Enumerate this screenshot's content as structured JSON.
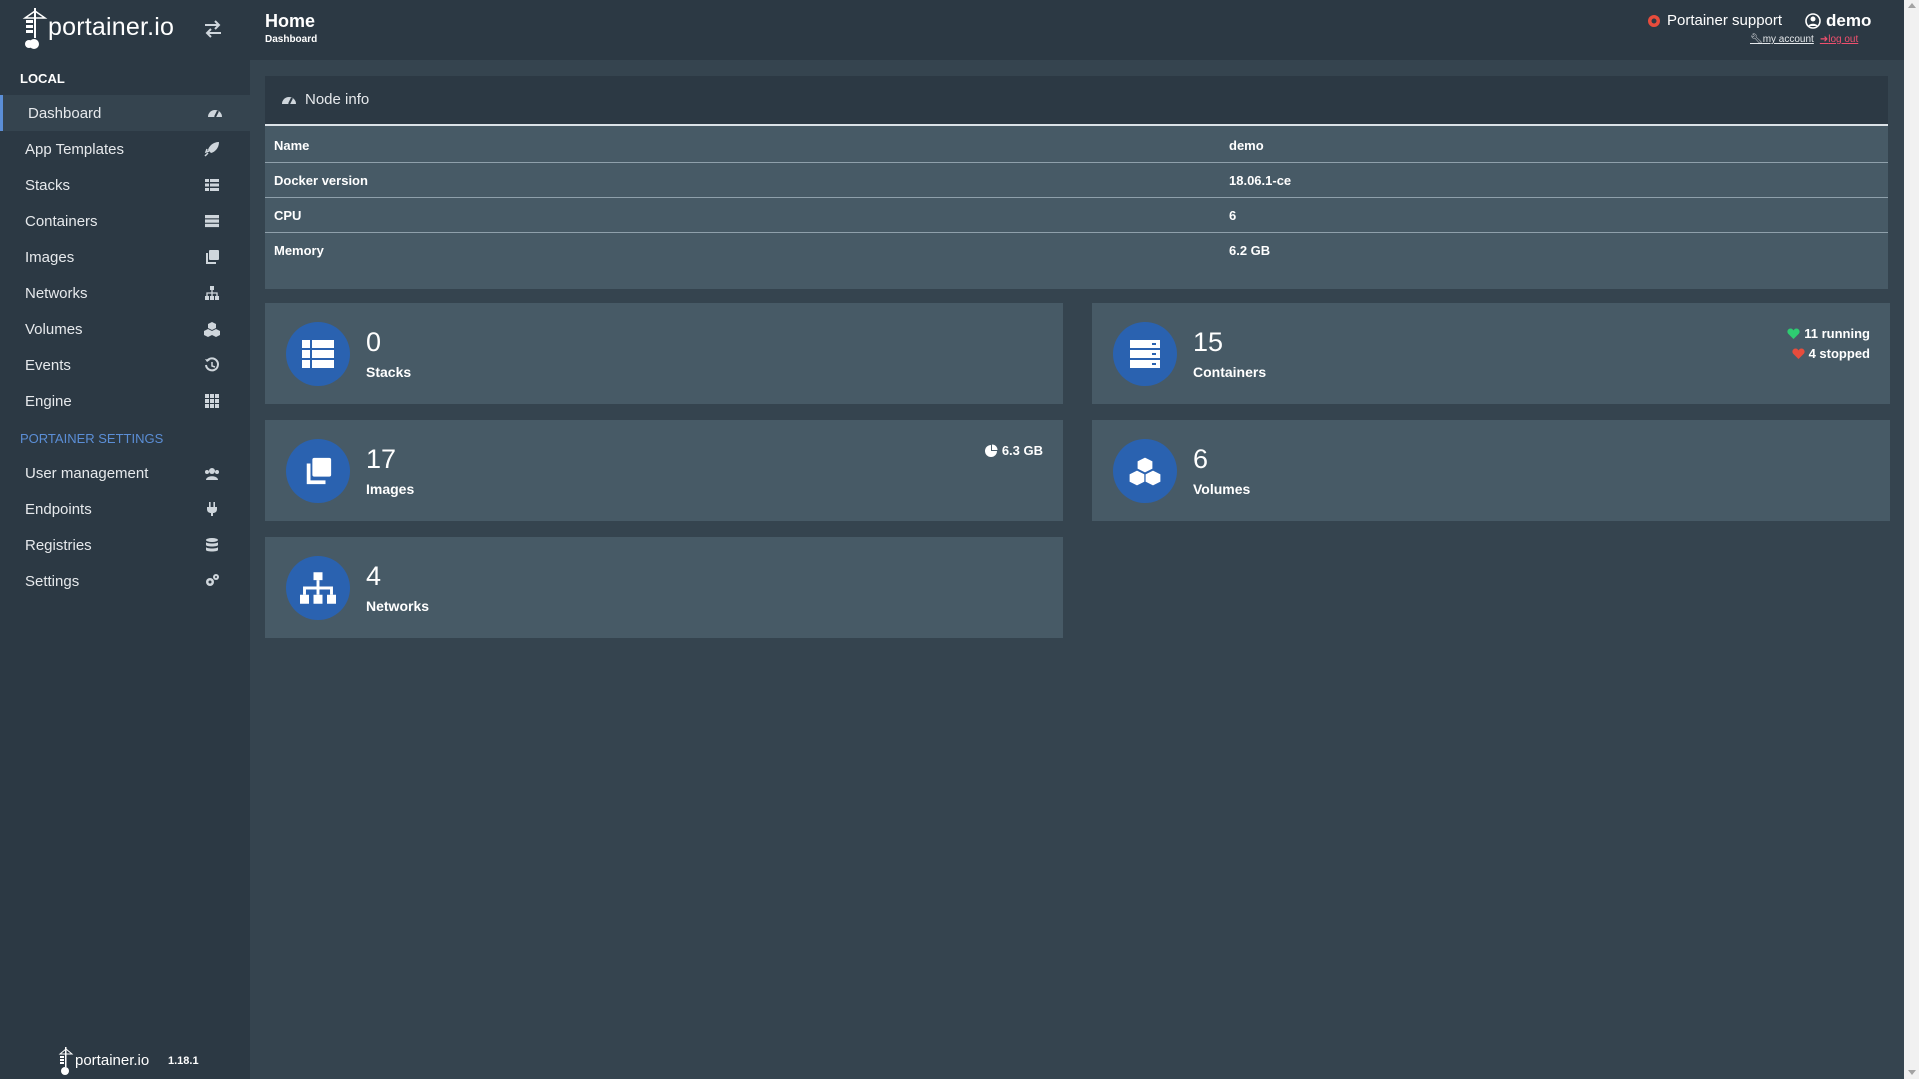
{
  "colors": {
    "sidebar_bg": "#2c3944",
    "content_bg": "#35444f",
    "panel_bg": "#475a66",
    "accent": "#5b8ed6",
    "tile_icon_bg": "#2a62b0",
    "running": "#2ecc71",
    "stopped": "#e74c3c",
    "logout": "#f0506e"
  },
  "brand": {
    "name": "portainer.io",
    "icon": "portainer-crane-icon",
    "toggle_icon": "exchange-arrows-icon"
  },
  "sidebar": {
    "section_local": "LOCAL",
    "items": [
      {
        "label": "Dashboard",
        "icon": "tachometer-icon",
        "active": true
      },
      {
        "label": "App Templates",
        "icon": "rocket-icon"
      },
      {
        "label": "Stacks",
        "icon": "th-list-icon"
      },
      {
        "label": "Containers",
        "icon": "server-icon"
      },
      {
        "label": "Images",
        "icon": "clone-icon"
      },
      {
        "label": "Networks",
        "icon": "sitemap-icon"
      },
      {
        "label": "Volumes",
        "icon": "cubes-icon"
      },
      {
        "label": "Events",
        "icon": "history-icon"
      },
      {
        "label": "Engine",
        "icon": "th-icon"
      }
    ],
    "section_settings": "PORTAINER SETTINGS",
    "settings_items": [
      {
        "label": "User management",
        "icon": "users-icon"
      },
      {
        "label": "Endpoints",
        "icon": "plug-icon"
      },
      {
        "label": "Registries",
        "icon": "database-icon"
      },
      {
        "label": "Settings",
        "icon": "cogs-icon"
      }
    ],
    "footer": {
      "name": "portainer.io",
      "version": "1.18.1"
    }
  },
  "header": {
    "title": "Home",
    "subtitle": "Dashboard",
    "support_label": "Portainer support",
    "user": "demo",
    "my_account": "my account",
    "log_out": "log out"
  },
  "node_info": {
    "title": "Node info",
    "rows": [
      {
        "key": "Name",
        "value": "demo"
      },
      {
        "key": "Docker version",
        "value": "18.06.1-ce"
      },
      {
        "key": "CPU",
        "value": "6"
      },
      {
        "key": "Memory",
        "value": "6.2 GB"
      }
    ]
  },
  "tiles": {
    "stacks": {
      "count": "0",
      "label": "Stacks",
      "icon": "th-list-icon"
    },
    "containers": {
      "count": "15",
      "label": "Containers",
      "icon": "server-icon",
      "running": "11 running",
      "stopped": "4 stopped"
    },
    "images": {
      "count": "17",
      "label": "Images",
      "icon": "clone-icon",
      "size": "6.3 GB"
    },
    "volumes": {
      "count": "6",
      "label": "Volumes",
      "icon": "cubes-icon"
    },
    "networks": {
      "count": "4",
      "label": "Networks",
      "icon": "sitemap-icon"
    }
  }
}
